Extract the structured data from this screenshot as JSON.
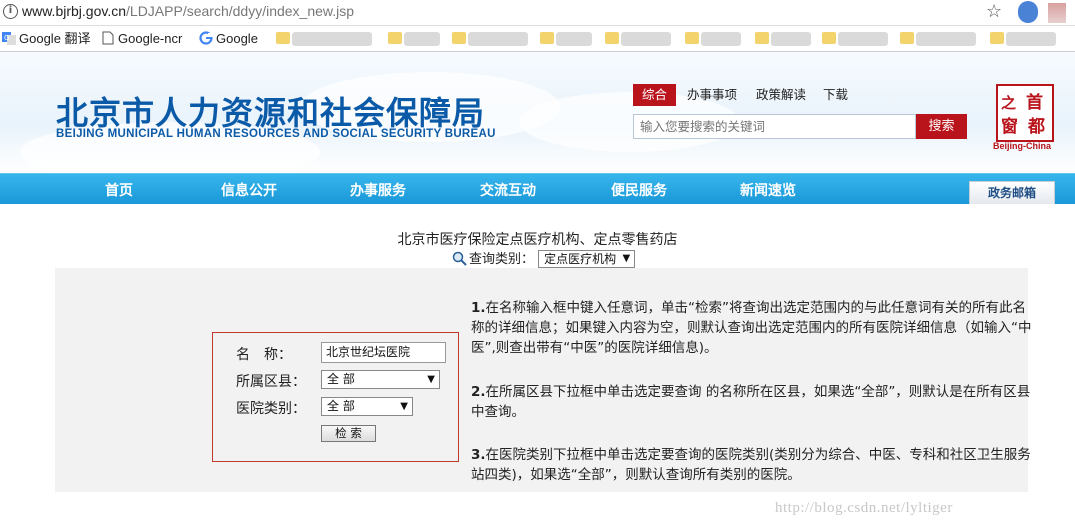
{
  "browser": {
    "url_host": "www.bjrbj.gov.cn",
    "url_path": "/LDJAPP/search/ddyy/index_new.jsp",
    "bookmarks": [
      {
        "label": "Google 翻译",
        "icon": "google-translate-icon"
      },
      {
        "label": "Google-ncr",
        "icon": "page-icon"
      },
      {
        "label": "Google",
        "icon": "google-icon"
      }
    ]
  },
  "header": {
    "title_cn": "北京市人力资源和社会保障局",
    "title_en": "BEIJING MUNICIPAL HUMAN RESOURCES AND SOCIAL SECURITY BUREAU",
    "top_nav": [
      "综合",
      "办事事项",
      "政策解读",
      "下载"
    ],
    "search_placeholder": "输入您要搜索的关键词",
    "search_button": "搜索",
    "seal_chars": [
      "首",
      "都",
      "之",
      "窗"
    ],
    "seal_caption": "Beijing-China"
  },
  "main_nav": [
    "首页",
    "信息公开",
    "办事服务",
    "交流互动",
    "便民服务",
    "新闻速览"
  ],
  "mailbox_label": "政务邮箱",
  "query": {
    "title": "北京市医疗保险定点医疗机构、定点零售药店",
    "type_label": "查询类别：",
    "type_value": "定点医疗机构"
  },
  "form": {
    "name_label": "名　称：",
    "name_value": "北京世纪坛医院",
    "district_label": "所属区县：",
    "district_value": "全 部",
    "hospital_type_label": "医院类别：",
    "hospital_type_value": "全 部",
    "search_button": "检 索"
  },
  "instructions": [
    {
      "num": "1.",
      "text": "在名称输入框中键入任意词，单击“检索”将查询出选定范围内的与此任意词有关的所有此名称的详细信息；如果键入内容为空，则默认查询出选定范围内的所有医院详细信息（如输入“中医”,则查出带有“中医”的医院详细信息)。"
    },
    {
      "num": "2.",
      "text": "在所属区县下拉框中单击选定要查询 的名称所在区县，如果选“全部”，则默认是在所有区县中查询。"
    },
    {
      "num": "3.",
      "text": "在医院类别下拉框中单击选定要查询的医院类别(类别分为综合、中医、专科和社区卫生服务站四类)，如果选“全部”，则默认查询所有类别的医院。"
    }
  ],
  "watermark": "http://blog.csdn.net/lyltiger",
  "colors": {
    "brand_blue": "#0b5aa8",
    "accent_red": "#b9141b",
    "nav_blue": "#1a98d8"
  }
}
